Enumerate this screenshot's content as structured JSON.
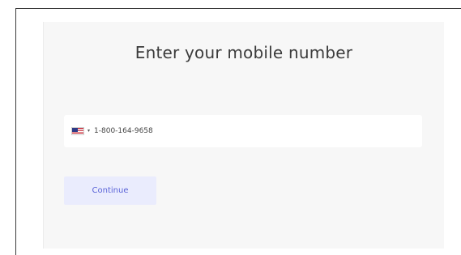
{
  "form": {
    "title": "Enter your mobile number",
    "country_flag_icon": "us-flag-icon",
    "country_dropdown_icon": "caret-down-icon",
    "caret_glyph": "▾",
    "phone_value": "1-800-164-9658",
    "continue_label": "Continue"
  },
  "colors": {
    "accent": "#5b64d8",
    "button_bg": "#eaecfd",
    "panel_bg": "#f7f7f7"
  }
}
